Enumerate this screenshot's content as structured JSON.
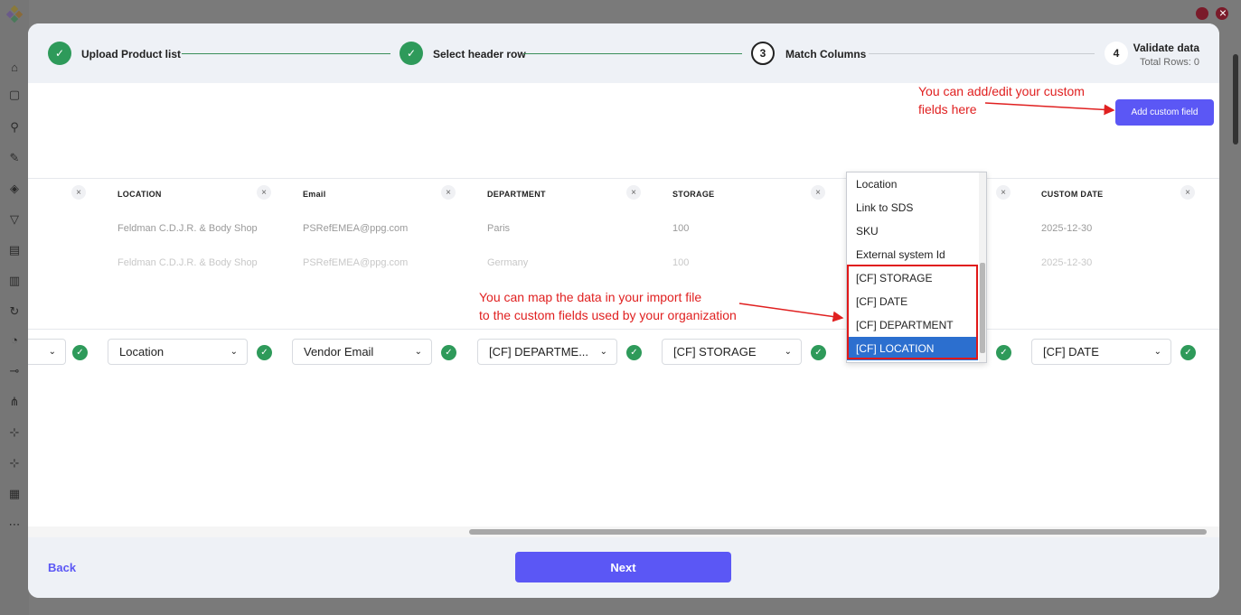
{
  "stepper": {
    "steps": [
      {
        "label": "Upload Product list",
        "state": "done",
        "number": ""
      },
      {
        "label": "Select header row",
        "state": "done",
        "number": ""
      },
      {
        "label": "Match Columns",
        "state": "current",
        "number": "3"
      },
      {
        "label": "Validate data",
        "state": "todo",
        "number": "4",
        "sub": "Total Rows: 0"
      }
    ]
  },
  "annotations": {
    "custom_field_note_line1": "You can add/edit your custom",
    "custom_field_note_line2": "fields here",
    "map_note_line1": "You can map the data in your import file",
    "map_note_line2": "to the custom fields used by your organization"
  },
  "toolbar": {
    "add_custom_field_label": "Add custom field"
  },
  "columns": [
    {
      "header": "LOCATION",
      "rows": [
        "Feldman C.D.J.R. & Body Shop",
        "Feldman C.D.J.R. & Body Shop"
      ],
      "mapped": "Location"
    },
    {
      "header": "Email",
      "rows": [
        "PSRefEMEA@ppg.com",
        "PSRefEMEA@ppg.com"
      ],
      "mapped": "Vendor Email"
    },
    {
      "header": "DEPARTMENT",
      "rows": [
        "Paris",
        "Germany"
      ],
      "mapped": "[CF] DEPARTME..."
    },
    {
      "header": "STORAGE",
      "rows": [
        "100",
        "100"
      ],
      "mapped": "[CF] STORAGE"
    },
    {
      "header": "CUSTOM DATE",
      "rows": [
        "2025-12-30",
        "2025-12-30"
      ],
      "mapped": "[CF] DATE"
    }
  ],
  "dropdown": {
    "options": [
      "Location",
      "Link to SDS",
      "SKU",
      "External system Id",
      "[CF] STORAGE",
      "[CF] DATE",
      "[CF] DEPARTMENT",
      "[CF] LOCATION"
    ],
    "highlighted": "[CF] LOCATION"
  },
  "footer": {
    "back_label": "Back",
    "next_label": "Next"
  },
  "colors": {
    "accent": "#5b57f5",
    "success": "#2e9a5a",
    "annotation": "#e02020",
    "highlight": "#2c6fcf"
  }
}
